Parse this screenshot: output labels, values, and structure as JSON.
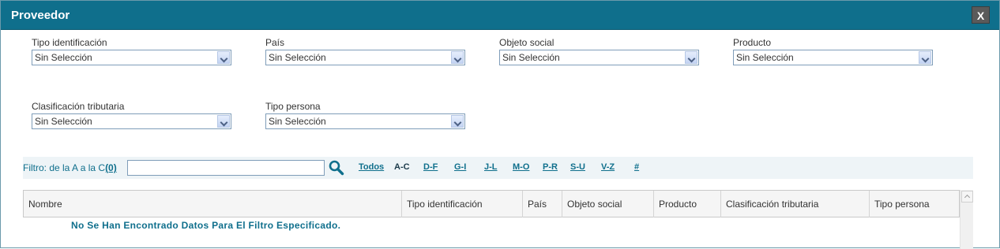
{
  "dialog": {
    "title": "Proveedor",
    "close_label": "X"
  },
  "filters": [
    {
      "label": "Tipo identificación",
      "value": "Sin Selección"
    },
    {
      "label": "País",
      "value": "Sin Selección"
    },
    {
      "label": "Objeto social",
      "value": "Sin Selección"
    },
    {
      "label": "Producto",
      "value": "Sin Selección"
    },
    {
      "label": "Clasificación tributaria",
      "value": "Sin Selección"
    },
    {
      "label": "Tipo persona",
      "value": "Sin Selección"
    }
  ],
  "filter_bar": {
    "label": "Filtro: de la A a la C",
    "count": "(0)",
    "input_value": "",
    "letters": [
      "Todos",
      "A-C",
      "D-F",
      "G-I",
      "J-L",
      "M-O",
      "P-R",
      "S-U",
      "V-Z",
      "#"
    ],
    "active_letter": "A-C"
  },
  "table": {
    "columns": [
      "Nombre",
      "Tipo identificación",
      "País",
      "Objeto social",
      "Producto",
      "Clasificación tributaria",
      "Tipo persona"
    ],
    "empty_message": "No Se Han Encontrado Datos Para El Filtro Especificado."
  },
  "colors": {
    "header": "#0f6f8c",
    "accent": "#0f6f8c"
  }
}
